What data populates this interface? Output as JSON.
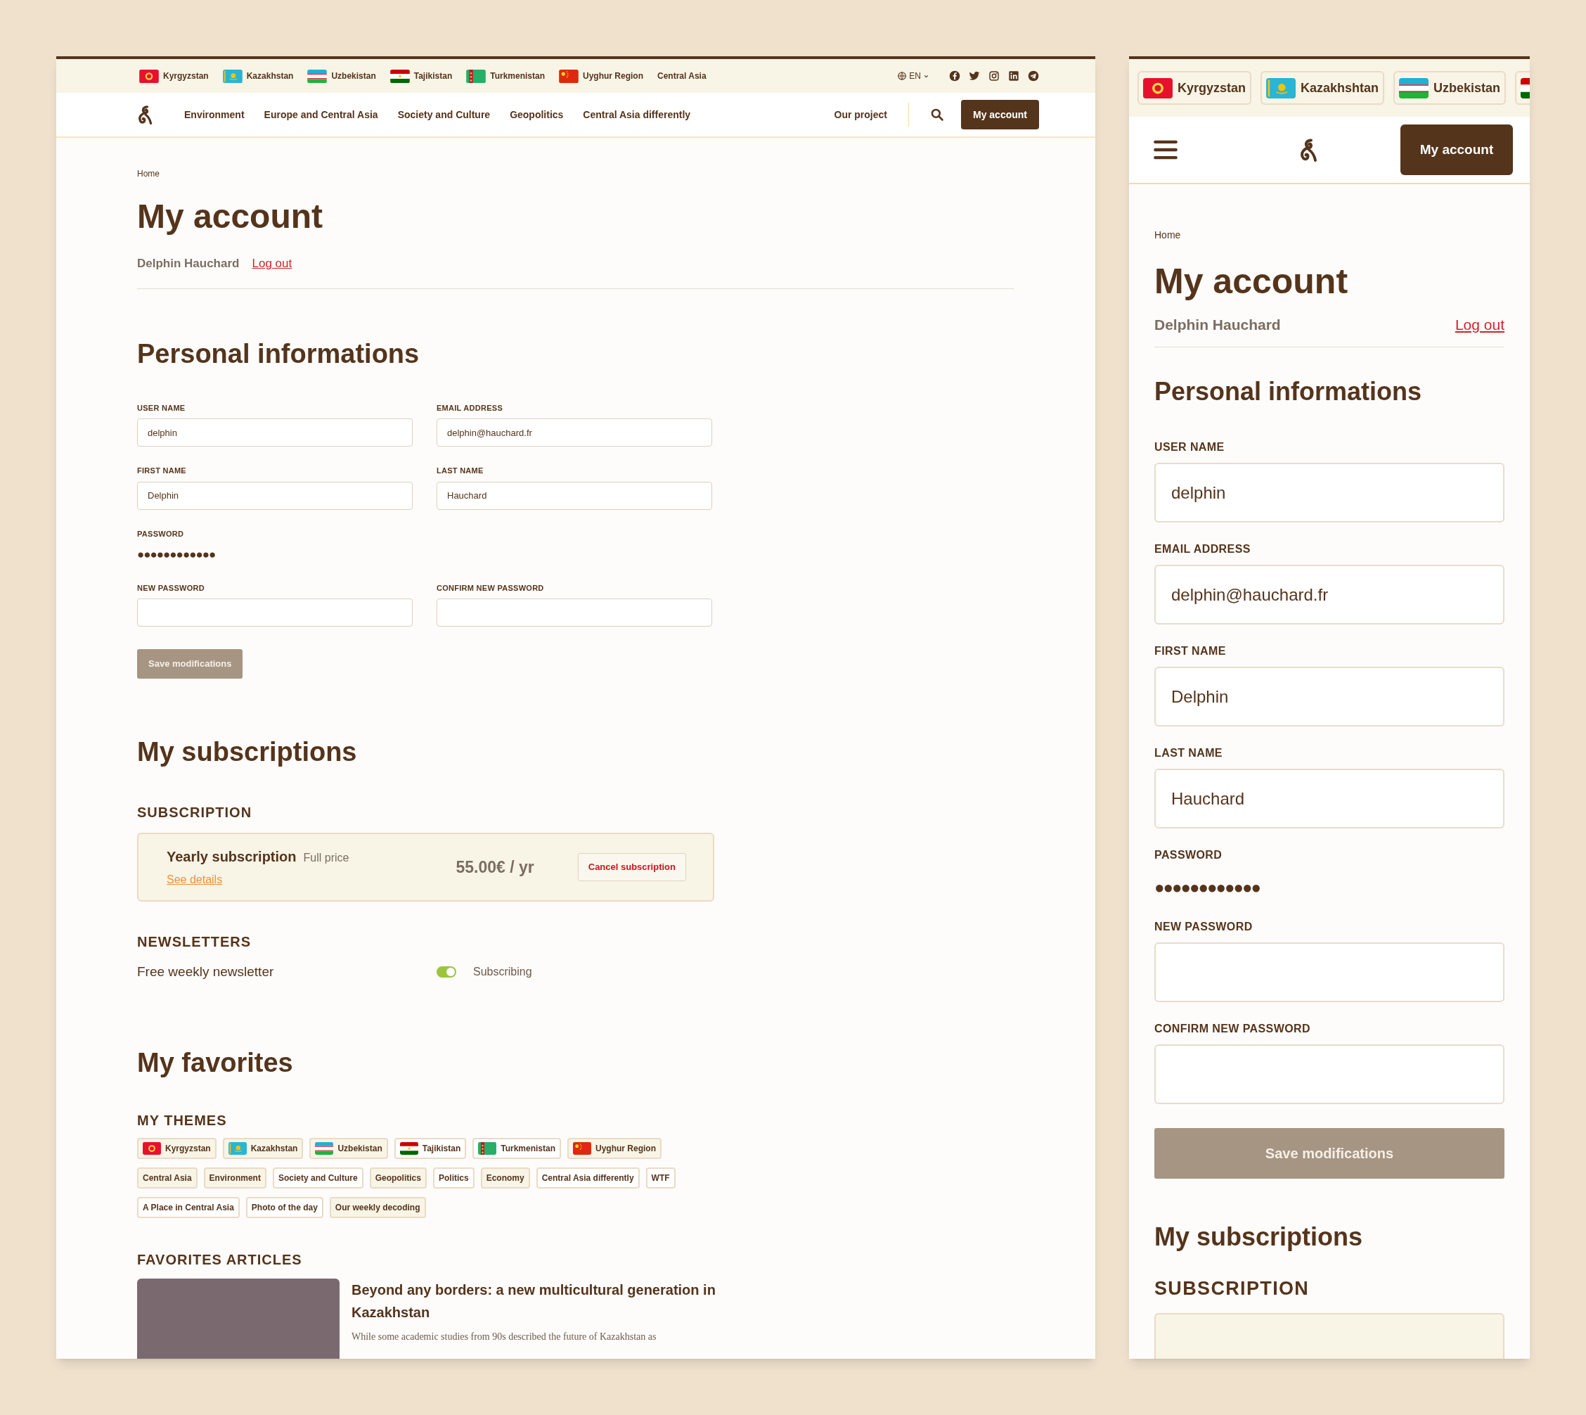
{
  "desktop": {
    "country_bar": [
      {
        "kind": "kg",
        "label": "Kyrgyzstan"
      },
      {
        "kind": "kz",
        "label": "Kazakhstan"
      },
      {
        "kind": "uz",
        "label": "Uzbekistan"
      },
      {
        "kind": "tj",
        "label": "Tajikistan"
      },
      {
        "kind": "tm",
        "label": "Turkmenistan"
      },
      {
        "kind": "cn",
        "label": "Uyghur Region"
      },
      {
        "kind": "plain",
        "label": "Central Asia"
      }
    ],
    "language": "EN",
    "nav": [
      "Environment",
      "Europe and Central Asia",
      "Society and Culture",
      "Geopolitics",
      "Central Asia differently"
    ],
    "our_project": "Our project",
    "account_button": "My account",
    "breadcrumb": "Home",
    "title": "My account",
    "user_name": "Delphin Hauchard",
    "logout": "Log out",
    "personal": {
      "heading": "Personal informations",
      "fields": [
        {
          "kind": "input",
          "label": "USER NAME",
          "value": "delphin"
        },
        {
          "kind": "input",
          "label": "EMAIL ADDRESS",
          "value": "delphin@hauchard.fr"
        },
        {
          "kind": "input",
          "label": "FIRST NAME",
          "value": "Delphin"
        },
        {
          "kind": "input",
          "label": "LAST NAME",
          "value": "Hauchard"
        },
        {
          "kind": "mask",
          "label": "PASSWORD",
          "value": "●●●●●●●●●●●●"
        },
        {
          "kind": "input",
          "label": "NEW PASSWORD"
        },
        {
          "kind": "input",
          "label": "CONFIRM NEW PASSWORD"
        }
      ],
      "save_button": {
        "label": "Save modifications",
        "disabled": true
      }
    },
    "subscriptions": {
      "heading": "My subscriptions",
      "subscription_label": "SUBSCRIPTION",
      "plan": {
        "name": "Yearly subscription",
        "note": "Full price",
        "details_link": "See details",
        "price": "55.00€ / yr",
        "cancel": "Cancel subscription"
      },
      "newsletters_label": "NEWSLETTERS",
      "newsletters": [
        {
          "name": "Free weekly newsletter",
          "on": true,
          "status": "Subscribing"
        }
      ]
    },
    "favorites": {
      "heading": "My favorites",
      "themes_label": "MY THEMES",
      "themes": [
        {
          "kind": "kg",
          "label": "Kyrgyzstan",
          "selected": true
        },
        {
          "kind": "kz",
          "label": "Kazakhstan",
          "selected": true
        },
        {
          "kind": "uz",
          "label": "Uzbekistan",
          "selected": true
        },
        {
          "kind": "tj",
          "label": "Tajikistan",
          "selected": false
        },
        {
          "kind": "tm",
          "label": "Turkmenistan",
          "selected": false
        },
        {
          "kind": "cn",
          "label": "Uyghur Region",
          "selected": true
        },
        {
          "kind": "plain",
          "label": "Central Asia",
          "selected": true
        },
        {
          "kind": "plain",
          "label": "Environment",
          "selected": true
        },
        {
          "kind": "plain",
          "label": "Society and Culture",
          "selected": false
        },
        {
          "kind": "plain",
          "label": "Geopolitics",
          "selected": true
        },
        {
          "kind": "plain",
          "label": "Politics",
          "selected": false
        },
        {
          "kind": "plain",
          "label": "Economy",
          "selected": true
        },
        {
          "kind": "plain",
          "label": "Central Asia differently",
          "selected": false
        },
        {
          "kind": "plain",
          "label": "WTF",
          "selected": false
        },
        {
          "kind": "plain",
          "label": "A Place in Central Asia",
          "selected": false
        },
        {
          "kind": "plain",
          "label": "Photo of the day",
          "selected": false
        },
        {
          "kind": "plain",
          "label": "Our weekly decoding",
          "selected": true
        }
      ],
      "articles_label": "FAVORITES ARTICLES",
      "articles": [
        {
          "title": "Beyond any borders: a new multicultural generation in Kazakhstan",
          "excerpt": "While some academic studies from 90s described the future of Kazakhstan as"
        }
      ]
    }
  },
  "mobile": {
    "country_bar": [
      {
        "kind": "kg",
        "label": "Kyrgyzstan"
      },
      {
        "kind": "kz",
        "label": "Kazakhshtan"
      },
      {
        "kind": "uz",
        "label": "Uzbekistan"
      },
      {
        "kind": "tj"
      }
    ],
    "account_button": "My account",
    "breadcrumb": "Home",
    "title": "My account",
    "user_name": "Delphin Hauchard",
    "logout": "Log out",
    "personal": {
      "heading": "Personal informations",
      "fields": [
        {
          "kind": "input",
          "label": "USER NAME",
          "value": "delphin"
        },
        {
          "kind": "input",
          "label": "EMAIL ADDRESS",
          "value": "delphin@hauchard.fr"
        },
        {
          "kind": "input",
          "label": "FIRST NAME",
          "value": "Delphin"
        },
        {
          "kind": "input",
          "label": "LAST NAME",
          "value": "Hauchard"
        },
        {
          "kind": "mask",
          "label": "PASSWORD",
          "value": "●●●●●●●●●●●●"
        },
        {
          "kind": "input",
          "label": "NEW PASSWORD"
        },
        {
          "kind": "input",
          "label": "CONFIRM NEW PASSWORD"
        }
      ],
      "save_button": {
        "label": "Save modifications",
        "disabled": true
      }
    },
    "subscriptions_heading": "My subscriptions",
    "subscription_label": "SUBSCRIPTION"
  }
}
